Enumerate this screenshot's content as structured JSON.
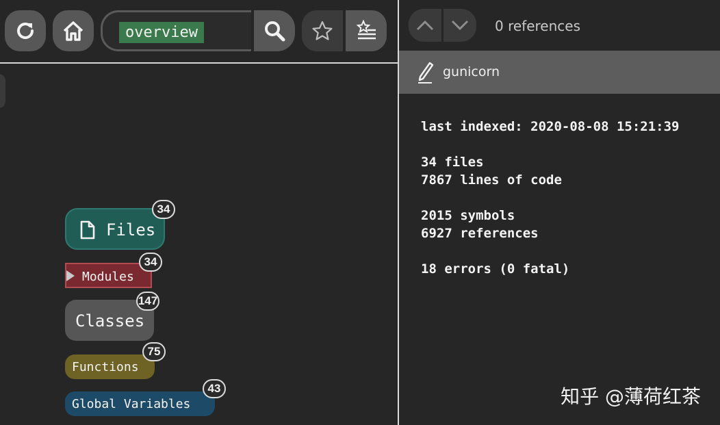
{
  "toolbar": {
    "buttons": [
      {
        "icon": "refresh-icon"
      },
      {
        "icon": "home-icon"
      },
      {
        "icon": "star-icon"
      },
      {
        "icon": "starred-list-icon"
      }
    ],
    "search": {
      "value": "overview",
      "icon": "search-icon"
    }
  },
  "tags": {
    "files": {
      "label": "Files",
      "count": "34",
      "color": "#1f5d55"
    },
    "modules": {
      "label": "Modules",
      "count": "34",
      "color": "#7a2930"
    },
    "classes": {
      "label": "Classes",
      "count": "147",
      "color": "#565656"
    },
    "functions": {
      "label": "Functions",
      "count": "75",
      "color": "#6e6224"
    },
    "globals": {
      "label": "Global Variables",
      "count": "43",
      "color": "#1d4a67"
    }
  },
  "references": {
    "count_label": "0 references"
  },
  "project": {
    "name": "gunicorn"
  },
  "stats": {
    "last_indexed": "last indexed: 2020-08-08 15:21:39",
    "files": "34 files",
    "lines": "7867 lines of code",
    "symbols": "2015 symbols",
    "references": "6927 references",
    "errors": "18 errors (0 fatal)"
  },
  "watermark": "知乎 @薄荷红茶"
}
